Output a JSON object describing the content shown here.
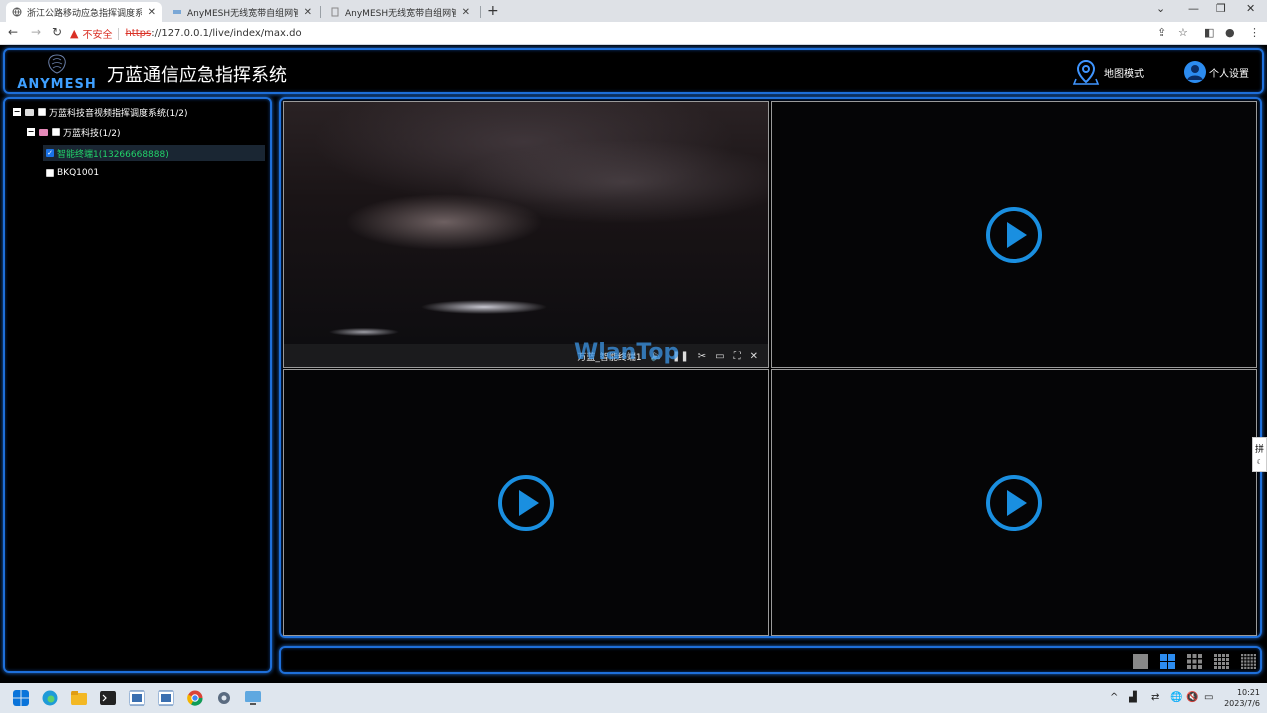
{
  "browser": {
    "tabs": [
      {
        "label": "浙江公路移动应急指挥调度系统",
        "active": true
      },
      {
        "label": "AnyMESH无线宽带自组网管理",
        "active": false
      },
      {
        "label": "AnyMESH无线宽带自组网管理",
        "active": false
      }
    ],
    "close_glyph": "✕",
    "new_tab_glyph": "+",
    "insecure_label": "不安全",
    "url_scheme": "https",
    "url_rest": "://127.0.0.1/live/index/max.do"
  },
  "header": {
    "logo_text": "ANYMESH",
    "title": "万蓝通信应急指挥系统",
    "map_mode_label": "地图模式",
    "settings_label": "个人设置"
  },
  "tree": {
    "root_label": "万蓝科技音视频指挥调度系统(1/2)",
    "group_label": "万蓝科技(1/2)",
    "device1_label": "智能终端1(13266668888)",
    "device2_label": "BKQ1001"
  },
  "video": {
    "cell1_caption": "万蓝_智能终端1",
    "watermark": "WlanTop"
  },
  "ime_label": "拼",
  "taskbar": {
    "time": "10:21",
    "date": "2023/7/6"
  },
  "colors": {
    "accent_blue": "#1e6fd9",
    "play_blue": "#1a8fe0",
    "online_green": "#22d36a"
  }
}
